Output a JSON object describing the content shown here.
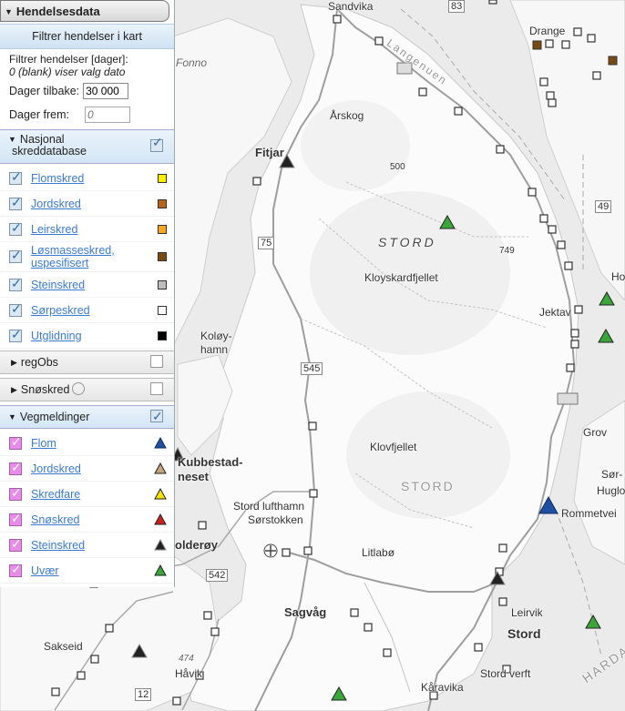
{
  "panel": {
    "title": "Hendelsesdata",
    "filter_button": "Filtrer hendelser i kart",
    "filter_line1": "Filtrer hendelser [dager]:",
    "filter_line2": "0 (blank) viser valg dato",
    "days_back_label": "Dager tilbake:",
    "days_back_value": "30 000",
    "days_forward_label": "Dager frem:",
    "days_forward_placeholder": "0",
    "sections": {
      "nasjonal": {
        "label_line1": "Nasjonal",
        "label_line2": "skreddatabase",
        "items": [
          {
            "label": "Flomskred",
            "color": "#ffee00"
          },
          {
            "label": "Jordskred",
            "color": "#b5651d"
          },
          {
            "label": "Leirskred",
            "color": "#f5a623"
          },
          {
            "label": "Løsmasseskred, uspesifisert",
            "label_line1": "Løsmasseskred,",
            "label_line2": "uspesifisert",
            "color": "#7a4a15"
          },
          {
            "label": "Steinskred",
            "color": "#bdbdbd"
          },
          {
            "label": "Sørpeskred",
            "color": "#ffffff"
          },
          {
            "label": "Utglidning",
            "color": "#000000"
          }
        ]
      },
      "regobs": {
        "label": "regObs"
      },
      "snoskred": {
        "label": "Snøskred"
      },
      "vegmeldinger": {
        "label": "Vegmeldinger",
        "items": [
          {
            "label": "Flom",
            "color": "#1f4fa0"
          },
          {
            "label": "Jordskred",
            "color": "#c8a47a"
          },
          {
            "label": "Skredfare",
            "color": "#f5e400"
          },
          {
            "label": "Snøskred",
            "color": "#d0201b"
          },
          {
            "label": "Steinskred",
            "color": "#222222"
          },
          {
            "label": "Uvær",
            "color": "#3aa63a"
          }
        ]
      }
    }
  },
  "map": {
    "place_labels": {
      "sandvika": "Sandvika",
      "langenuen": "Langenuen",
      "drange": "Drange",
      "fonno": "Fonno",
      "arskog": "Årskog",
      "fitjar": "Fitjar",
      "h500": "500",
      "stord_big": "STORD",
      "h749": "749",
      "road75": "75",
      "road49": "49",
      "ho": "Ho",
      "klovskardfjellet": "Kloyskardfjellet",
      "jektav": "Jektav",
      "koloy": "Koløy-",
      "hamn": "hamn",
      "road545": "545",
      "grov": "Grov",
      "klovfjellet": "Klovfjellet",
      "kubbestad1": "Kubbestad-",
      "kubbestad2": "neset",
      "stord_faded": "STORD",
      "sor": "Sør-",
      "huglo": "Huglo",
      "stord_lufthamn": "Stord lufthamn",
      "sorstokken": "Sørstokken",
      "rommetveit": "Rommetvei",
      "olderoy": "olderøy",
      "litlabo": "Litlabø",
      "road542": "542",
      "sagvag": "Sagvåg",
      "leirvik": "Leirvik",
      "stord_town": "Stord",
      "sakseid": "Sakseid",
      "h474": "474",
      "havik": "Håvik",
      "stord_verft": "Stord verft",
      "kaavika": "Kåravika",
      "road12": "12",
      "road83": "83",
      "harda": "HARDA"
    }
  }
}
